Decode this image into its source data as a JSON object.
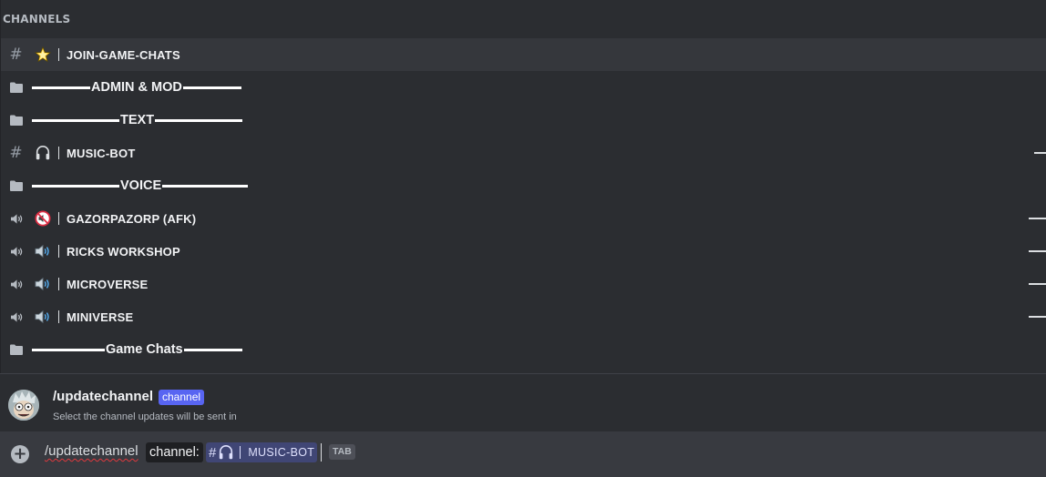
{
  "header": {
    "title": "CHANNELS"
  },
  "channels": [
    {
      "kind": "text",
      "emoji": "star",
      "name": "JOIN-GAME-CHATS"
    },
    {
      "kind": "category",
      "name": "ADMIN & MOD"
    },
    {
      "kind": "category",
      "name": "TEXT"
    },
    {
      "kind": "text",
      "emoji": "headphones",
      "name": "MUSIC-BOT"
    },
    {
      "kind": "category",
      "name": "VOICE"
    },
    {
      "kind": "voice",
      "emoji": "muted-speaker",
      "name": "GAZORPAZORP (AFK)"
    },
    {
      "kind": "voice",
      "emoji": "speaker",
      "name": "RICKS WORKSHOP"
    },
    {
      "kind": "voice",
      "emoji": "speaker",
      "name": "MICROVERSE"
    },
    {
      "kind": "voice",
      "emoji": "speaker",
      "name": "MINIVERSE"
    },
    {
      "kind": "category",
      "name": "Game Chats"
    }
  ],
  "command": {
    "name": "/updatechannel",
    "badge": "channel",
    "description": "Select the channel updates will be sent in"
  },
  "input": {
    "command": "/updatechannel",
    "option_label": "channel:",
    "option_hash": "#",
    "option_value": "MUSIC-BOT",
    "tab_hint": "TAB"
  },
  "colors": {
    "background": "#2b2d31",
    "highlight": "#35373c",
    "input_bg": "#383a40",
    "blurple": "#5865f2"
  }
}
